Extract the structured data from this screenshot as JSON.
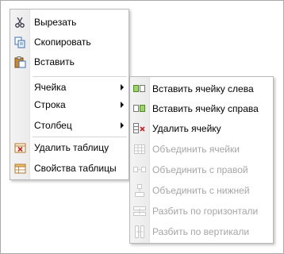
{
  "context_menu": {
    "items": [
      {
        "label": "Вырезать",
        "icon": "scissors-icon"
      },
      {
        "label": "Скопировать",
        "icon": "copy-icon"
      },
      {
        "label": "Вставить",
        "icon": "paste-icon"
      },
      {
        "label": "Ячейка",
        "has_submenu": true
      },
      {
        "label": "Строка",
        "has_submenu": true
      },
      {
        "label": "Столбец",
        "has_submenu": true
      },
      {
        "label": "Удалить таблицу",
        "icon": "delete-table-icon"
      },
      {
        "label": "Свойства таблицы",
        "icon": "table-properties-icon"
      }
    ]
  },
  "cell_submenu": {
    "items": [
      {
        "label": "Вставить ячейку слева",
        "icon": "insert-cell-left-icon",
        "enabled": true
      },
      {
        "label": "Вставить ячейку справа",
        "icon": "insert-cell-right-icon",
        "enabled": true
      },
      {
        "label": "Удалить ячейку",
        "icon": "delete-cell-icon",
        "enabled": true
      },
      {
        "label": "Объединить ячейки",
        "icon": "merge-cells-icon",
        "enabled": false
      },
      {
        "label": "Объединить с правой",
        "icon": "merge-right-icon",
        "enabled": false
      },
      {
        "label": "Объединить с нижней",
        "icon": "merge-down-icon",
        "enabled": false
      },
      {
        "label": "Разбить по горизонтали",
        "icon": "split-horizontal-icon",
        "enabled": false
      },
      {
        "label": "Разбить по вертикали",
        "icon": "split-vertical-icon",
        "enabled": false
      }
    ]
  },
  "colors": {
    "menu_border": "#b8b8b8",
    "disabled_text": "#a6a6a6",
    "icon_green": "#5fa32e",
    "icon_red": "#cc2222"
  }
}
